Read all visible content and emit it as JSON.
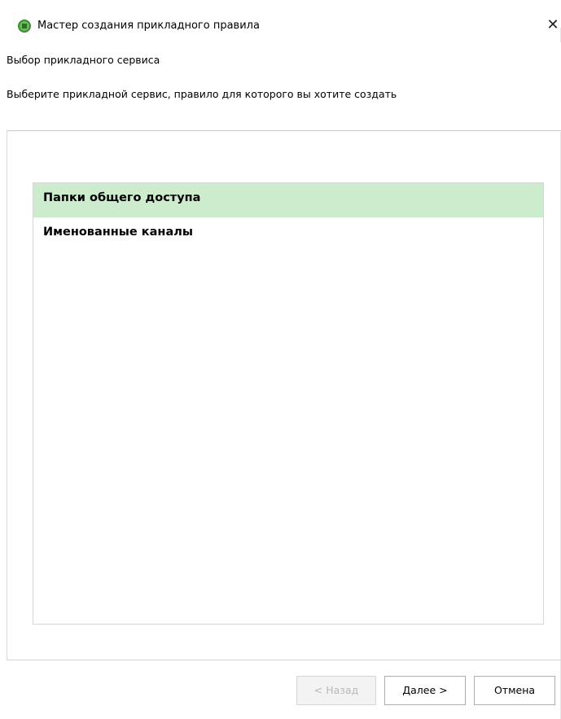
{
  "window": {
    "title": "Мастер создания прикладного правила",
    "close_glyph": "✕"
  },
  "header": {
    "step_title": "Выбор прикладного сервиса",
    "step_description": "Выберите прикладной сервис, правило для которого вы хотите создать"
  },
  "services": {
    "items": [
      {
        "label": "Папки общего доступа",
        "selected": true
      },
      {
        "label": "Именованные каналы",
        "selected": false
      }
    ]
  },
  "buttons": {
    "back_label": "< Назад",
    "back_enabled": false,
    "next_label": "Далее >",
    "cancel_label": "Отмена"
  },
  "colors": {
    "selection": "#cdeccd",
    "app_icon": "#6abe5d"
  },
  "icons": {
    "app": "app-shield-icon",
    "close": "close-icon"
  }
}
